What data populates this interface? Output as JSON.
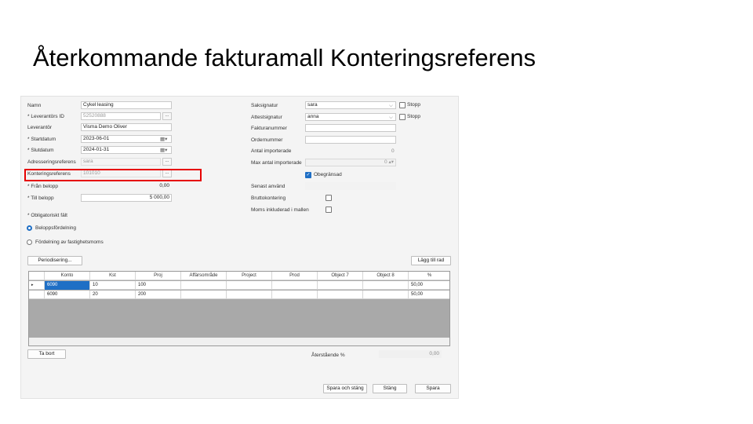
{
  "slide": {
    "title": "Återkommande fakturamall Konteringsreferens"
  },
  "form": {
    "left": {
      "namn_label": "Namn",
      "namn_value": "Cykel leasing",
      "levid_label": "* Leverantörs ID",
      "levid_value": "52520888",
      "lev_label": "Leverantör",
      "lev_value": "Visma Demo Oliver",
      "start_label": "* Startdatum",
      "start_value": "2023-06-01",
      "slut_label": "* Slutdatum",
      "slut_value": "2024-01-31",
      "adress_label": "Adresseringsreferens",
      "adress_value": "sara",
      "kont_label": "Konteringsreferens",
      "kont_value": "101010",
      "fran_label": "* Från belopp",
      "fran_value": "0,00",
      "till_label": "* Till belopp",
      "till_value": "5 000,00",
      "oblig_text": "* Obligatoriskt fält",
      "radio1_label": "Beloppsfördelning",
      "radio2_label": "Fördelning av fastighetsmoms",
      "dots": "...",
      "cal": "▦▾"
    },
    "right": {
      "saksig_label": "Saksignatur",
      "saksig_value": "sara",
      "attest_label": "Attestsignatur",
      "attest_value": "anna",
      "stopp_label": "Stopp",
      "faktnr_label": "Fakturanummer",
      "ordernr_label": "Ordernummer",
      "antal_label": "Antal importerade",
      "antal_value": "0",
      "max_label": "Max antal importerade",
      "max_value": "0 ▴▾",
      "obegr_label": "Obegränsad",
      "senast_label": "Senast använd",
      "brutto_label": "Bruttokontering",
      "moms_label": "Moms inkluderad i mallen",
      "chevron": "⌵",
      "check": "✓"
    },
    "buttons": {
      "periodisering": "Periodisering...",
      "lagg_till": "Lägg till rad",
      "ta_bort": "Ta bort",
      "spara_stang": "Spara och stäng",
      "stang": "Stäng",
      "spara": "Spara"
    },
    "remaining": {
      "label": "Återstående %",
      "value": "0,00"
    },
    "grid": {
      "headers": [
        "Konto",
        "Kst",
        "Proj",
        "Affärsområde",
        "Project",
        "Prod",
        "Object 7",
        "Object 8",
        "%"
      ],
      "rows": [
        {
          "marker": "▸",
          "cells": [
            "6090",
            "10",
            "100",
            "",
            "",
            "",
            "",
            "",
            "50,00"
          ]
        },
        {
          "marker": "",
          "cells": [
            "6090",
            "20",
            "200",
            "",
            "",
            "",
            "",
            "",
            "50,00"
          ]
        }
      ]
    }
  },
  "colors": {
    "accent": "#1f6fc5",
    "highlight": "#e60000"
  }
}
